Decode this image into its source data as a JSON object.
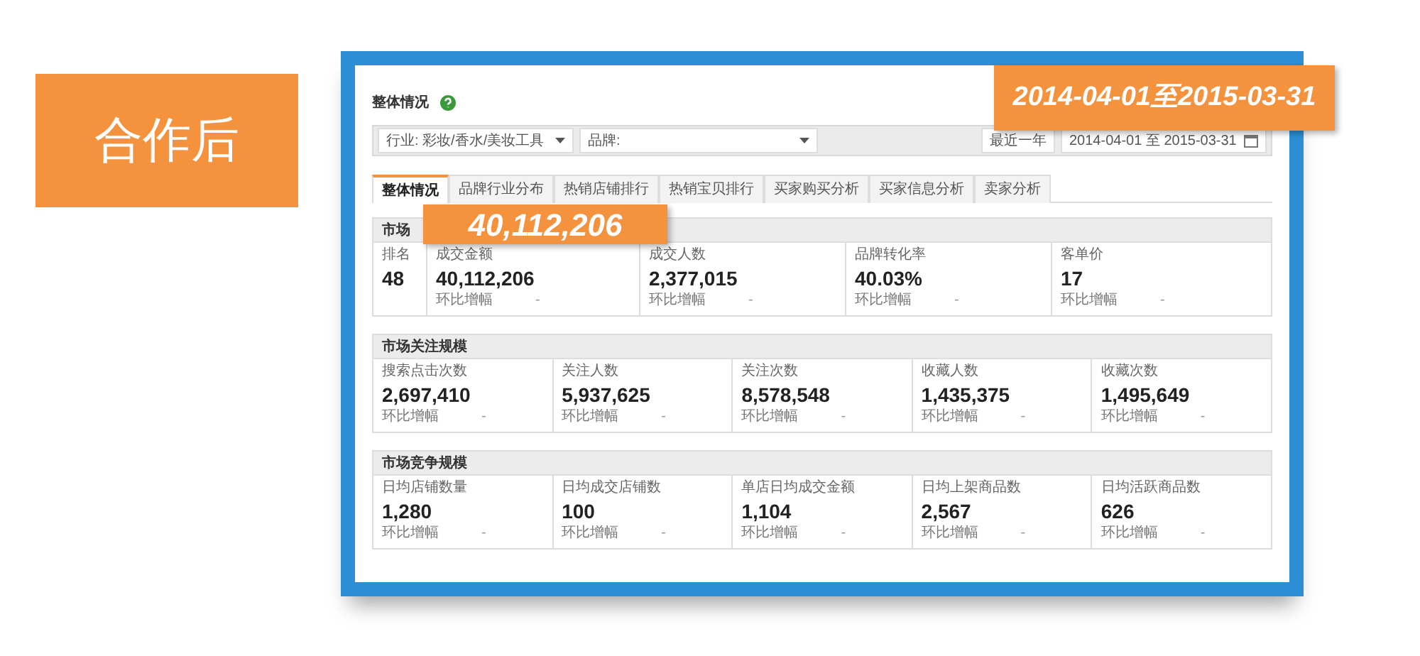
{
  "badge": {
    "text": "合作后"
  },
  "panel": {
    "title": "整体情况"
  },
  "filters": [
    {
      "kind": "select",
      "value": "行业: 彩妆/香水/美妆工具"
    },
    {
      "kind": "select",
      "value": "品牌:"
    },
    {
      "kind": "spacer"
    },
    {
      "kind": "select",
      "value": "最近一年"
    },
    {
      "kind": "date",
      "value": "2014-04-01 至 2015-03-31"
    }
  ],
  "tabs": [
    {
      "label": "整体情况",
      "selected": true
    },
    {
      "label": "品牌行业分布",
      "selected": false
    },
    {
      "label": "热销店铺排行",
      "selected": false
    },
    {
      "label": "热销宝贝排行",
      "selected": false
    },
    {
      "label": "买家购买分析",
      "selected": false
    },
    {
      "label": "买家信息分析",
      "selected": false
    },
    {
      "label": "卖家分析",
      "selected": false
    }
  ],
  "sections": [
    {
      "title": "市场",
      "metrics": [
        {
          "label": "排名",
          "value": "48"
        },
        {
          "label": "成交金额",
          "value": "40,112,206",
          "change_label": "环比增幅",
          "change": "-"
        },
        {
          "label": "成交人数",
          "value": "2,377,015",
          "change_label": "环比增幅",
          "change": "-"
        },
        {
          "label": "品牌转化率",
          "value": "40.03%",
          "change_label": "环比增幅",
          "change": "-"
        },
        {
          "label": "客单价",
          "value": "17",
          "change_label": "环比增幅",
          "change": "-"
        }
      ]
    },
    {
      "title": "市场关注规模",
      "metrics": [
        {
          "label": "搜索点击次数",
          "value": "2,697,410",
          "change_label": "环比增幅",
          "change": "-"
        },
        {
          "label": "关注人数",
          "value": "5,937,625",
          "change_label": "环比增幅",
          "change": "-"
        },
        {
          "label": "关注次数",
          "value": "8,578,548",
          "change_label": "环比增幅",
          "change": "-"
        },
        {
          "label": "收藏人数",
          "value": "1,435,375",
          "change_label": "环比增幅",
          "change": "-"
        },
        {
          "label": "收藏次数",
          "value": "1,495,649",
          "change_label": "环比增幅",
          "change": "-"
        }
      ]
    },
    {
      "title": "市场竞争规模",
      "metrics": [
        {
          "label": "日均店铺数量",
          "value": "1,280",
          "change_label": "环比增幅",
          "change": "-"
        },
        {
          "label": "日均成交店铺数",
          "value": "100",
          "change_label": "环比增幅",
          "change": "-"
        },
        {
          "label": "单店日均成交金额",
          "value": "1,104",
          "change_label": "环比增幅",
          "change": "-"
        },
        {
          "label": "日均上架商品数",
          "value": "2,567",
          "change_label": "环比增幅",
          "change": "-"
        },
        {
          "label": "日均活跃商品数",
          "value": "626",
          "change_label": "环比增幅",
          "change": "-"
        }
      ]
    }
  ],
  "callouts": [
    {
      "text": "2014-04-01至2015-03-31"
    },
    {
      "text": "40,112,206"
    }
  ]
}
